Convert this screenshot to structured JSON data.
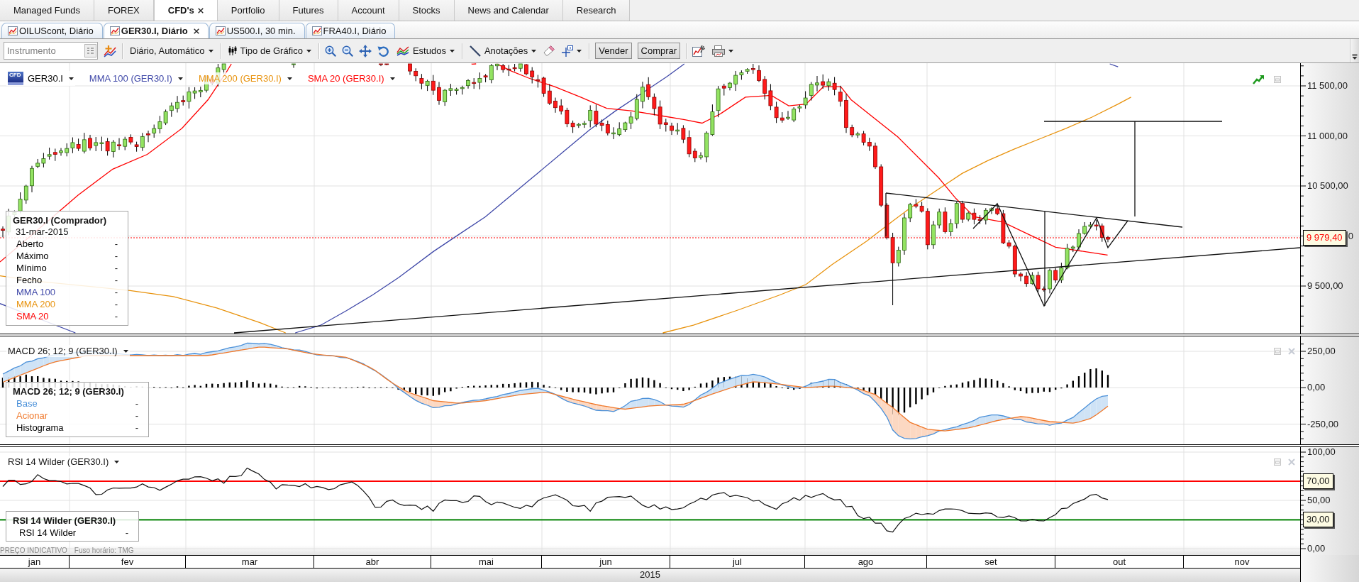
{
  "main_tabs": [
    {
      "label": "Managed Funds",
      "selected": false,
      "closable": false
    },
    {
      "label": "FOREX",
      "selected": false,
      "closable": false
    },
    {
      "label": "CFD's",
      "selected": true,
      "closable": true
    },
    {
      "label": "Portfolio",
      "selected": false,
      "closable": false
    },
    {
      "label": "Futures",
      "selected": false,
      "closable": false
    },
    {
      "label": "Account",
      "selected": false,
      "closable": false
    },
    {
      "label": "Stocks",
      "selected": false,
      "closable": false
    },
    {
      "label": "News and Calendar",
      "selected": false,
      "closable": false
    },
    {
      "label": "Research",
      "selected": false,
      "closable": false
    }
  ],
  "chart_tabs": [
    {
      "label": "OILUScont, Diário",
      "selected": false,
      "closable": false
    },
    {
      "label": "GER30.I, Diário",
      "selected": true,
      "closable": true
    },
    {
      "label": "US500.I, 30 min.",
      "selected": false,
      "closable": false
    },
    {
      "label": "FRA40.I, Diário",
      "selected": false,
      "closable": false
    }
  ],
  "toolbar": {
    "instrument": {
      "placeholder": "Instrumento"
    },
    "interval": "Diário, Automático",
    "chart_type": "Tipo de Gráfico",
    "studies": "Estudos",
    "annotations": "Anotações",
    "sell": "Vender",
    "buy": "Comprar"
  },
  "price_pane": {
    "legend": [
      {
        "kind": "instrument",
        "badge": "CFD",
        "label": "GER30.I",
        "color": "#000000"
      },
      {
        "kind": "study",
        "label": "MMA 100 (GER30.I)",
        "color": "#3f48a8"
      },
      {
        "kind": "study",
        "label": "MMA 200 (GER30.I)",
        "color": "#e8920c"
      },
      {
        "kind": "study",
        "label": "SMA 20 (GER30.I)",
        "color": "#ff0000"
      }
    ],
    "data_window": {
      "title": "GER30.I (Comprador)",
      "date": "31-mar-2015",
      "rows": [
        {
          "label": "Aberto",
          "value": "-",
          "color": "#000000"
        },
        {
          "label": "Máximo",
          "value": "-",
          "color": "#000000"
        },
        {
          "label": "Mínimo",
          "value": "-",
          "color": "#000000"
        },
        {
          "label": "Fecho",
          "value": "-",
          "color": "#000000"
        },
        {
          "label": "MMA 100",
          "value": "-",
          "color": "#3f48a8"
        },
        {
          "label": "MMA 200",
          "value": "-",
          "color": "#e8920c"
        },
        {
          "label": "SMA 20",
          "value": "-",
          "color": "#ff0000"
        }
      ]
    },
    "axis_labels": [
      {
        "text": "11 500,00",
        "covered": false
      },
      {
        "text": "11 000,00",
        "covered": false
      },
      {
        "text": "10 500,00",
        "covered": false
      },
      {
        "text": "0",
        "covered": true
      },
      {
        "text": "9 500,00",
        "covered": false
      }
    ],
    "last_price": {
      "text": "9 979,40",
      "color": "#ff0000"
    }
  },
  "macd_pane": {
    "legend": "MACD 26; 12; 9 (GER30.I)",
    "data_window": {
      "title": "MACD 26; 12; 9 (GER30.I)",
      "rows": [
        {
          "label": "Base",
          "value": "-",
          "color": "#4a90d9"
        },
        {
          "label": "Acionar",
          "value": "-",
          "color": "#f0782a"
        },
        {
          "label": "Histograma",
          "value": "-",
          "color": "#000000"
        }
      ]
    },
    "axis_labels": [
      "250,00",
      "0,00",
      "-250,00"
    ]
  },
  "rsi_pane": {
    "legend": "RSI 14 Wilder (GER30.I)",
    "data_window": {
      "title": "RSI 14 Wilder (GER30.I)",
      "rows": [
        {
          "label": "RSI 14 Wilder",
          "value": "-",
          "color": "#000000"
        }
      ]
    },
    "axis_labels": [
      "100,00",
      "50,00",
      "0,00"
    ],
    "level_tags": [
      {
        "text": "70,00",
        "color": "#ff0000"
      },
      {
        "text": "30,00",
        "color": "#008000"
      }
    ],
    "notice": "PREÇO INDICATIVO",
    "timezone": "Fuso horário: TMG"
  },
  "time_axis": {
    "months": [
      "jan",
      "fev",
      "mar",
      "abr",
      "mai",
      "jun",
      "jul",
      "ago",
      "set",
      "out",
      "nov"
    ],
    "year": "2015"
  }
}
